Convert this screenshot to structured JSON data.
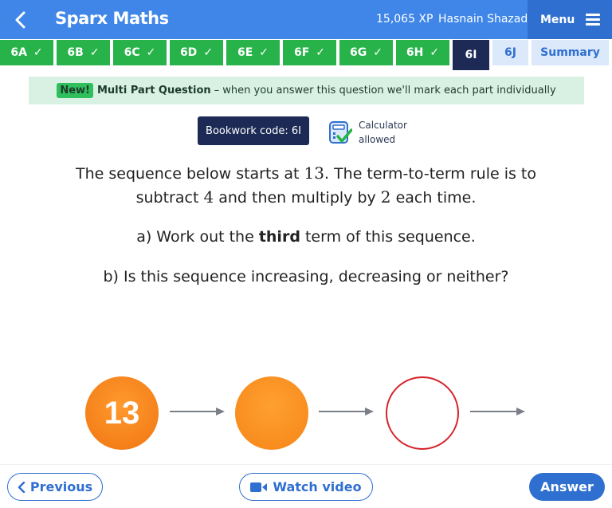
{
  "header": {
    "title": "Sparx Maths",
    "xp": "15,065 XP",
    "username": "Hasnain Shazad",
    "menu_label": "Menu"
  },
  "tabs": [
    {
      "label": "6A",
      "status": "complete"
    },
    {
      "label": "6B",
      "status": "complete"
    },
    {
      "label": "6C",
      "status": "complete"
    },
    {
      "label": "6D",
      "status": "complete"
    },
    {
      "label": "6E",
      "status": "complete"
    },
    {
      "label": "6F",
      "status": "complete"
    },
    {
      "label": "6G",
      "status": "complete"
    },
    {
      "label": "6H",
      "status": "complete"
    },
    {
      "label": "6I",
      "status": "current"
    },
    {
      "label": "6J",
      "status": "pending"
    },
    {
      "label": "Summary",
      "status": "summary"
    }
  ],
  "banner": {
    "badge": "New!",
    "bold": "Multi Part Question",
    "text": "– when you answer this question we'll mark each part individually"
  },
  "bookwork": {
    "label": "Bookwork code: 6I"
  },
  "calculator": {
    "line1": "Calculator",
    "line2": "allowed"
  },
  "question": {
    "line1_a": "The sequence below starts at ",
    "start": "13",
    "line1_b": ". The term-to-term rule is to",
    "line2_a": "subtract ",
    "subtract": "4",
    "line2_b": " and then multiply by ",
    "multiply": "2",
    "line2_c": " each time.",
    "part_a_pre": "a) Work out the ",
    "part_a_bold": "third",
    "part_a_post": " term of this sequence.",
    "part_b": "b) Is this sequence increasing, decreasing or neither?"
  },
  "sequence": {
    "first_term": "13"
  },
  "footer": {
    "previous": "Previous",
    "watch_video": "Watch video",
    "answer": "Answer"
  },
  "colors": {
    "header_blue": "#3f86e8",
    "tab_green": "#27b34a",
    "tab_current": "#1c2a55",
    "accent_blue": "#2f6fd0",
    "circle_orange": "#f58516",
    "circle_red_outline": "#d6232a"
  }
}
